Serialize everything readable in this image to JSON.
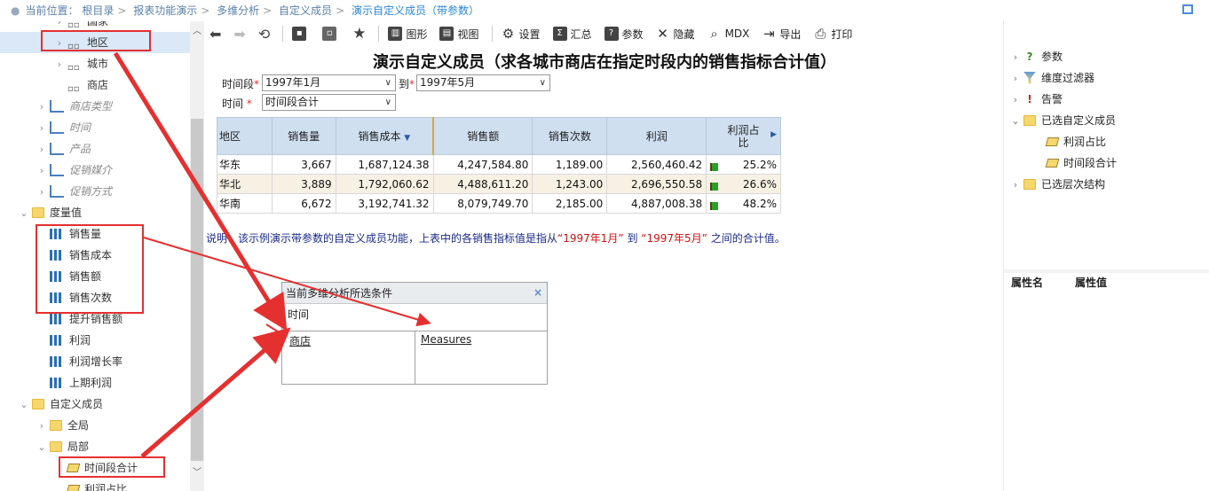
{
  "breadcrumb": {
    "items": [
      "当前位置：",
      "根目录",
      "报表功能演示",
      "多维分析",
      "自定义成员",
      "演示自定义成员（带参数）"
    ],
    "sep": ">"
  },
  "left_tree": {
    "items": [
      {
        "label": "国家",
        "type": "grid",
        "indent": 2,
        "arrow": "›"
      },
      {
        "label": "地区",
        "type": "grid",
        "indent": 2,
        "arrow": "›",
        "selected": true
      },
      {
        "label": "城市",
        "type": "grid",
        "indent": 2,
        "arrow": "›"
      },
      {
        "label": "商店",
        "type": "grid",
        "indent": 2,
        "arrow": ""
      },
      {
        "label": "商店类型",
        "type": "hier",
        "indent": 1,
        "arrow": "›"
      },
      {
        "label": "时间",
        "type": "hier",
        "indent": 1,
        "arrow": "›"
      },
      {
        "label": "产品",
        "type": "hier",
        "indent": 1,
        "arrow": "›"
      },
      {
        "label": "促销媒介",
        "type": "hier",
        "indent": 1,
        "arrow": "›"
      },
      {
        "label": "促销方式",
        "type": "hier",
        "indent": 1,
        "arrow": "›"
      },
      {
        "label": "度量值",
        "type": "folder",
        "indent": 0,
        "arrow": "⌄"
      },
      {
        "label": "销售量",
        "type": "bars",
        "indent": 1,
        "arrow": ""
      },
      {
        "label": "销售成本",
        "type": "bars",
        "indent": 1,
        "arrow": ""
      },
      {
        "label": "销售额",
        "type": "bars",
        "indent": 1,
        "arrow": ""
      },
      {
        "label": "销售次数",
        "type": "bars",
        "indent": 1,
        "arrow": ""
      },
      {
        "label": "提升销售额",
        "type": "bars",
        "indent": 1,
        "arrow": ""
      },
      {
        "label": "利润",
        "type": "bars",
        "indent": 1,
        "arrow": ""
      },
      {
        "label": "利润增长率",
        "type": "bars",
        "indent": 1,
        "arrow": ""
      },
      {
        "label": "上期利润",
        "type": "bars",
        "indent": 1,
        "arrow": ""
      },
      {
        "label": "自定义成员",
        "type": "folder",
        "indent": 0,
        "arrow": "⌄"
      },
      {
        "label": "全局",
        "type": "folder",
        "indent": 1,
        "arrow": "›"
      },
      {
        "label": "局部",
        "type": "folder",
        "indent": 1,
        "arrow": "⌄"
      },
      {
        "label": "时间段合计",
        "type": "custom",
        "indent": 2,
        "arrow": ""
      },
      {
        "label": "利润占比",
        "type": "custom",
        "indent": 2,
        "arrow": ""
      }
    ]
  },
  "toolbar": {
    "back_icon": "arrow-left-icon",
    "forward_icon": "arrow-right-icon",
    "refresh_icon": "refresh-icon",
    "items": [
      {
        "label": "图形",
        "icon": "chart-icon"
      },
      {
        "label": "视图",
        "icon": "view-icon"
      },
      {
        "label": "设置",
        "icon": "gear-icon"
      },
      {
        "label": "汇总",
        "icon": "sum-icon"
      },
      {
        "label": "参数",
        "icon": "question-icon"
      },
      {
        "label": "隐藏",
        "icon": "hide-icon"
      },
      {
        "label": "MDX",
        "icon": "search-icon"
      },
      {
        "label": "导出",
        "icon": "export-icon"
      },
      {
        "label": "打印",
        "icon": "print-icon"
      }
    ]
  },
  "report": {
    "title": "演示自定义成员（求各城市商店在指定时段内的销售指标合计值）"
  },
  "params": {
    "period_label": "时间段",
    "req": "*",
    "from_value": "1997年1月",
    "to_label": "到",
    "to_value": "1997年5月",
    "time_label": "时间",
    "time_value": "时间段合计"
  },
  "table": {
    "headers": [
      "地区",
      "销售量",
      "销售成本",
      "销售额",
      "销售次数",
      "利润",
      "利润占比"
    ],
    "sort_icon": "▼",
    "rows": [
      [
        "华东",
        "3,667",
        "1,687,124.38",
        "4,247,584.80",
        "1,189.00",
        "2,560,460.42",
        "25.2%"
      ],
      [
        "华北",
        "3,889",
        "1,792,060.62",
        "4,488,611.20",
        "1,243.00",
        "2,696,550.58",
        "26.6%"
      ],
      [
        "华南",
        "6,672",
        "3,192,741.32",
        "8,079,749.70",
        "2,185.00",
        "4,887,008.38",
        "48.2%"
      ]
    ]
  },
  "note": {
    "prefix": "说明：该示例演示带参数的自定义成员功能，上表中的各销售指标值是指从",
    "from": "“1997年1月”",
    "mid": "到",
    "to": "“1997年5月”",
    "suffix": "之间的合计值。"
  },
  "condition_panel": {
    "title": "当前多维分析所选条件",
    "close": "×",
    "row1": "时间",
    "cell_left": "商店",
    "cell_right": "Measures"
  },
  "right_tree": {
    "items": [
      {
        "label": "参数",
        "icon": "question-icon",
        "arrow": "›",
        "indent": 0
      },
      {
        "label": "维度过滤器",
        "icon": "filter-icon",
        "arrow": "›",
        "indent": 0
      },
      {
        "label": "告警",
        "icon": "alert-icon",
        "arrow": "›",
        "indent": 0
      },
      {
        "label": "已选自定义成员",
        "icon": "folder-icon",
        "arrow": "⌄",
        "indent": 0
      },
      {
        "label": "利润占比",
        "icon": "custom-member-icon",
        "arrow": "",
        "indent": 1
      },
      {
        "label": "时间段合计",
        "icon": "custom-member-icon",
        "arrow": "",
        "indent": 1
      },
      {
        "label": "已选层次结构",
        "icon": "folder-icon",
        "arrow": "›",
        "indent": 0
      }
    ]
  },
  "properties": {
    "name_header": "属性名",
    "value_header": "属性值"
  },
  "colors": {
    "annotation": "#e53030",
    "header_bg": "#cfdff0",
    "alt_row": "#f7f1e4",
    "selected_row": "#dbe8f7"
  }
}
